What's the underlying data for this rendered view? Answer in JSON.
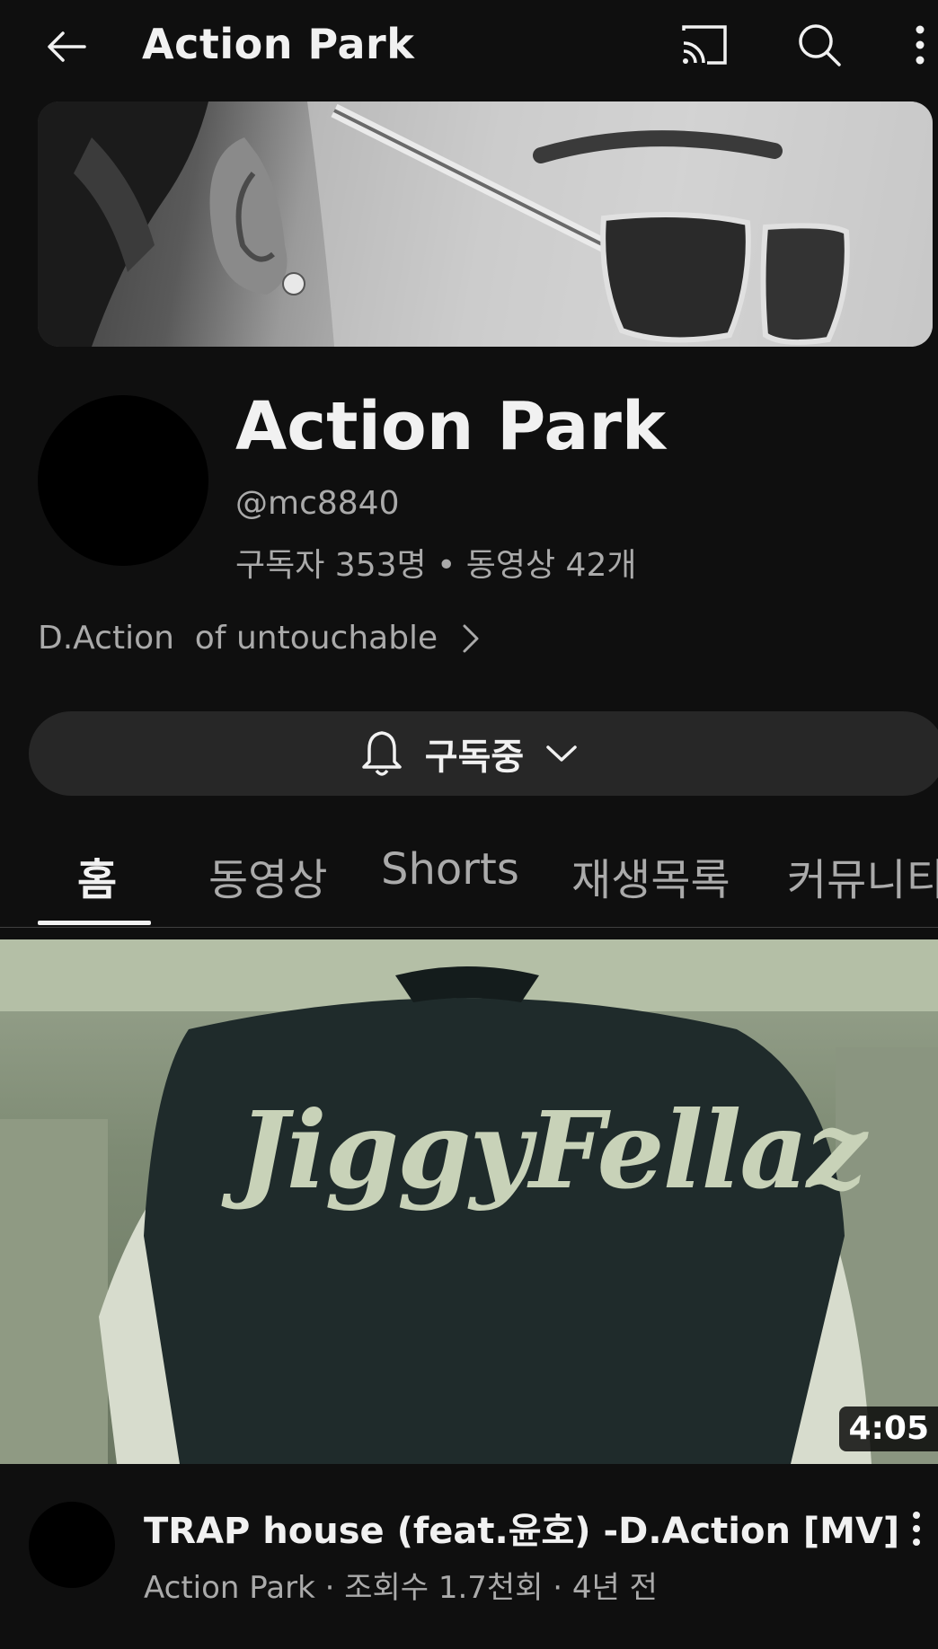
{
  "topbar": {
    "title": "Action Park",
    "back_icon": "arrow-left-icon",
    "cast_icon": "cast-icon",
    "search_icon": "search-icon",
    "more_icon": "more-vertical-icon"
  },
  "channel": {
    "name": "Action Park",
    "handle": "@mc8840",
    "stats": "구독자 353명 • 동영상 42개",
    "description": "D.Action  of untouchable"
  },
  "subscribe": {
    "label": "구독중",
    "bell_icon": "bell-icon",
    "chevron_icon": "chevron-down-icon"
  },
  "tabs": [
    {
      "label": "홈",
      "active": true
    },
    {
      "label": "동영상",
      "active": false
    },
    {
      "label": "Shorts",
      "active": false
    },
    {
      "label": "재생목록",
      "active": false
    },
    {
      "label": "커뮤니티",
      "active": false
    }
  ],
  "video": {
    "thumbnail_text": "JiggyFellaz",
    "duration": "4:05",
    "title": "TRAP house (feat.윤호) -D.Action [MV]",
    "meta": "Action Park · 조회수 1.7천회 · 4년 전"
  },
  "colors": {
    "background": "#0f0f0f",
    "surface": "#272727",
    "text_primary": "#f1f1f1",
    "text_secondary": "#aaaaaa"
  }
}
